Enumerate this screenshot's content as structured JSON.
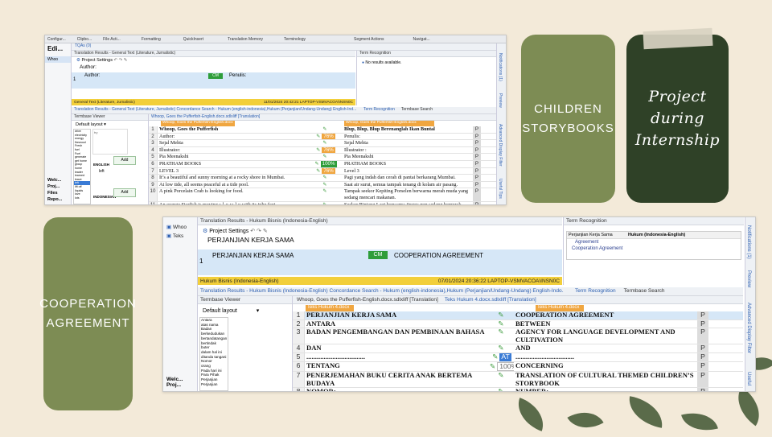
{
  "pills": {
    "children": "CHILDREN\nSTORYBOOKS",
    "project": "Project during\nInternship",
    "cooperation": "COOPERATION\nAGREEMENT"
  },
  "colors": {
    "background": "#f3ead9",
    "pill_light": "#7d8c54",
    "pill_dark": "#2f4127",
    "yellow_bar": "#f2cf3a",
    "tm_match": "#2e9d3a"
  },
  "shot1": {
    "ribbon": [
      "Configur...",
      "Clipbo...",
      "File Acti...",
      "Formatting",
      "QuickInsert",
      "Translation Memory",
      "Terminology",
      "Segment Actions",
      "Navigat..."
    ],
    "nav": {
      "edit_label": "Edi...",
      "nav_items": [
        "Welc...",
        "Proj...",
        "Files",
        "Repo..."
      ],
      "tab": "TQAs (0)",
      "whoo": "Whoo"
    },
    "translation_results_header": "Translation Results - General Text (Literature, Jurnalistic)",
    "project_settings": "Project Settings",
    "author_label": "Author:",
    "tm_row": {
      "num": "1",
      "source": "Author:",
      "badge": "CM",
      "target": "Penulis:"
    },
    "term_recognition": {
      "title": "Term Recognition",
      "empty": "No results available."
    },
    "yellow": {
      "left": "General Text (Literature, Jurnalistic)",
      "right": "11/01/2024 20:42:21   LAPTOP-VSMVACOA\\INSN0C"
    },
    "tabs_line": "Translation Results - General Text (Literature, Jurnalistic)   Concordance Search - Hukum (english-indonesia),Hukum (Perjanjian/Undang-Undang) English-Ind...",
    "tabs_right": [
      "Term Recognition",
      "Termbase Search"
    ],
    "termbase_viewer": "Termbase Viewer",
    "default_layout": "Default layout",
    "termlist": [
      "drive",
      "electricity",
      "energy",
      "firewood",
      "Fresh",
      "fuel",
      "Fuel",
      "generate",
      "get home",
      "group",
      "home",
      "leader",
      "learned",
      "leave",
      "left",
      "lift off",
      "liquids",
      "love",
      "lots"
    ],
    "termbase_word": "ENGLISH",
    "termbase_value": "left",
    "termbase_lang2": "INDONESIAN",
    "add_label": "Add",
    "doc_tab": "Whoop, Goes the Pufferfish-English.docx.sdlxliff [Translation]",
    "src_header": "Whoop, Goes the Pufferfish-English.docx",
    "tgt_header": "Whoop, Goes the Pufferfish-English.docx",
    "rows": [
      {
        "n": "1",
        "s": "Whoop, Goes the Pufferfish",
        "st": "",
        "t": "Blup, Blup, Blup Berenanglah Ikan Buntal",
        "p": "P",
        "bold": true
      },
      {
        "n": "2",
        "s": "Author:",
        "st": "76%",
        "t": "Penulis:",
        "p": "P"
      },
      {
        "n": "3",
        "s": "Sejal Mehta",
        "st": "",
        "t": "Sejal Mehta",
        "p": "P"
      },
      {
        "n": "4",
        "s": "Illustrator:",
        "st": "76%",
        "t": "Illustrator :",
        "p": "P"
      },
      {
        "n": "5",
        "s": "Pia Meenakshi",
        "st": "",
        "t": "Pia Meenakshi",
        "p": "P"
      },
      {
        "n": "6",
        "s": "PRATHAM BOOKS",
        "st": "100%",
        "t": "PRATHAM BOOKS",
        "p": "P"
      },
      {
        "n": "7",
        "s": "LEVEL 3",
        "st": "76%",
        "t": "Level 3",
        "p": "P"
      },
      {
        "n": "8",
        "s": "It’s a beautiful and sunny morning at a rocky shore in Mumbai.",
        "st": "",
        "t": "Pagi yang indah dan cerah di pantai berkarang Mumbai.",
        "p": "P"
      },
      {
        "n": "9",
        "s": "At low tide, all seems peaceful at a tide pool.",
        "st": "",
        "t": "Saat air surut, semua tampak tenang di kolam air pasang.",
        "p": "P"
      },
      {
        "n": "10",
        "s": "A pink Porcelain Crab is looking for food.",
        "st": "",
        "t": "Tampak seekor Kepiting Porselen berwarna merah muda yang sedang mencari makanan.",
        "p": "P"
      },
      {
        "n": "11",
        "s": "An orange Starfish is moving s-l-o-w-l-y with its tube feet.",
        "st": "",
        "t": "Seekor Bintang Laut berwarna jingga pun sedang bergerak",
        "p": "P"
      }
    ],
    "side_tabs": [
      "Notifications (1)",
      "Preview",
      "Advanced Display Filter",
      "Useful Tips"
    ]
  },
  "shot2": {
    "nav": {
      "items": [
        "Whoo",
        "Teks"
      ],
      "bottom": [
        "Welc...",
        "Proj..."
      ]
    },
    "translation_results_header": "Translation Results - Hukum  Bisnis (Indonesia-English)",
    "term_recognition": "Term Recognition",
    "project_settings": "Project Settings",
    "heading": "PERJANJIAN KERJA SAMA",
    "tm_row": {
      "num": "1",
      "source": "PERJANJIAN KERJA SAMA",
      "badge": "CM",
      "target": "COOPERATION AGREEMENT"
    },
    "term_table": {
      "col1": "Perjanjian Kerja Sama",
      "col2": "Hukum (Indonesia-English)",
      "terms": [
        "Agreement",
        "Cooperation Agreement"
      ]
    },
    "yellow": {
      "left": "Hukum  Bisnis (Indonesia-English)",
      "right": "07/01/2024 20:36:22   LAPTOP-VSMVACOA\\INSN0C"
    },
    "tabs_line": "Translation Results - Hukum  Bisnis (Indonesia-English)   Concordance Search - Hukum (english-indonesia),Hukum (Perjanjian/Undang-Undang) English-Indo...",
    "tabs_right": [
      "Term Recognition",
      "Termbase Search"
    ],
    "termbase_viewer": "Termbase Viewer",
    "default_layout": "Default layout",
    "termlist": [
      "Antara",
      "atas nama",
      "Badan",
      "berkedudukan",
      "bertandatangan",
      "bertindak",
      "buter",
      "dalam hal ini",
      "ditanda tangani",
      "Nomor",
      "orang",
      "Pada hari ini",
      "Para Pihak",
      "Perjanjian",
      "Perjanjian"
    ],
    "doc_tabs": [
      "Whoop, Goes the Pufferfish-English.docx.sdlxliff [Translation]",
      "Teks Hukum 4.docx.sdlxliff [Translation]"
    ],
    "src_header": "Teks Hukum 4.docx",
    "tgt_header": "Teks Hukum 4.docx",
    "rows": [
      {
        "n": "1",
        "s": "PERJANJIAN KERJA SAMA",
        "st": "",
        "t": "COOPERATION AGREEMENT",
        "p": "P"
      },
      {
        "n": "2",
        "s": "ANTARA",
        "st": "",
        "t": "BETWEEN",
        "p": "P"
      },
      {
        "n": "3",
        "s": "BADAN PENGEMBANGAN DAN PEMBINAAN BAHASA",
        "st": "",
        "t": "AGENCY FOR LANGUAGE DEVELOPMENT AND CULTIVATION",
        "p": "P"
      },
      {
        "n": "4",
        "s": "DAN",
        "st": "",
        "t": "AND",
        "p": "P"
      },
      {
        "n": "5",
        "s": "..................................",
        "st": "AT",
        "t": "..................................",
        "p": "P"
      },
      {
        "n": "6",
        "s": "TENTANG",
        "st": "100%",
        "t": "CONCERNING",
        "p": "P"
      },
      {
        "n": "7",
        "s": "PENERJEMAHAN BUKU CERITA ANAK BERTEMA BUDAYA",
        "st": "",
        "t": "TRANSLATION OF CULTURAL THEMED CHILDREN’S STORYBOOK",
        "p": "P"
      },
      {
        "n": "8",
        "s": "NOMOR:",
        "st": "",
        "t": "NUMBER:",
        "p": "P"
      }
    ],
    "side_tabs": [
      "Notifications (1)",
      "Preview",
      "Advanced Display Filter",
      "Useful"
    ]
  }
}
